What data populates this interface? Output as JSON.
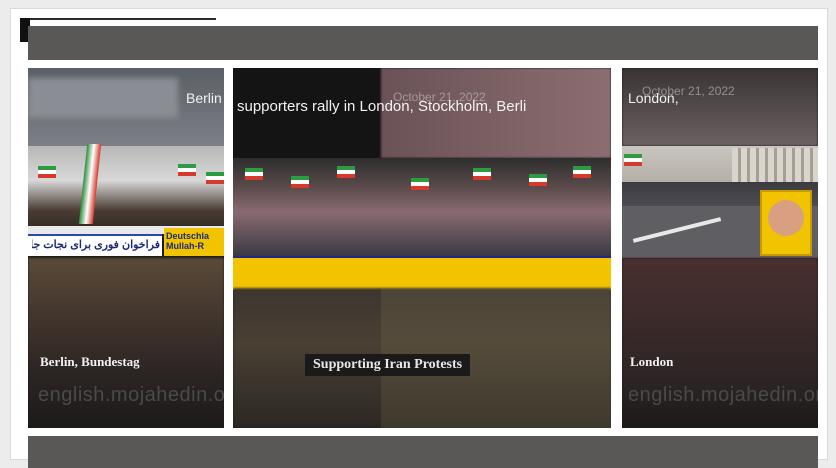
{
  "colors": {
    "bar": "#5a5757",
    "card": "#ffffff",
    "banner": "#f2c400",
    "banner_text": "#1a2a7a"
  },
  "tiles": {
    "left": {
      "top_label": "Berlin",
      "banner": "فراخوان فوری برای نجات جان ز",
      "banner_side": "Deutschla Mullah-R",
      "caption": "Berlin, Bundestag",
      "watermark": "english.mojahedin.org/"
    },
    "middle": {
      "heading": "supporters rally in London, Stockholm, Berli",
      "date": "October 21, 2022",
      "badge": "Supporting Iran Protests"
    },
    "right": {
      "top_label": "London,",
      "date": "October 21, 2022",
      "caption": "London",
      "watermark": "english.mojahedin.org/"
    }
  }
}
